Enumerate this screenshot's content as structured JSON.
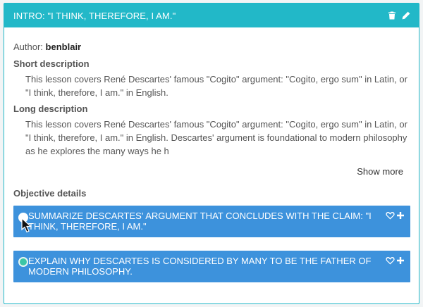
{
  "header": {
    "title": "INTRO: \"I THINK, THEREFORE, I AM.\"",
    "delete_icon": "trash-icon",
    "edit_icon": "pencil-icon"
  },
  "author": {
    "label": "Author:",
    "name": "benblair"
  },
  "short_description": {
    "label": "Short description",
    "text": "This lesson covers René Descartes' famous \"Cogito\" argument: \"Cogito, ergo sum\" in Latin, or \"I think, therefore, I am.\" in English."
  },
  "long_description": {
    "label": "Long description",
    "text": "This lesson covers René Descartes' famous \"Cogito\" argument: \"Cogito, ergo sum\" in Latin, or \"I think, therefore, I am.\" in English. Descartes' argument is foundational to modern philosophy as he explores the many ways he h"
  },
  "show_more_label": "Show more",
  "objectives": {
    "label": "Objective details",
    "items": [
      {
        "text": "SUMMARIZE DESCARTES' ARGUMENT THAT CONCLUDES WITH THE CLAIM: \"I THINK, THEREFORE, I AM.\"",
        "radio_color": "#ffffff"
      },
      {
        "text": "EXPLAIN WHY DESCARTES IS CONSIDERED BY MANY TO BE THE FATHER OF MODERN PHILOSOPHY.",
        "radio_color": "#3cc6a6"
      }
    ]
  },
  "colors": {
    "header": "#22b8c8",
    "objective": "#3d92dc"
  }
}
